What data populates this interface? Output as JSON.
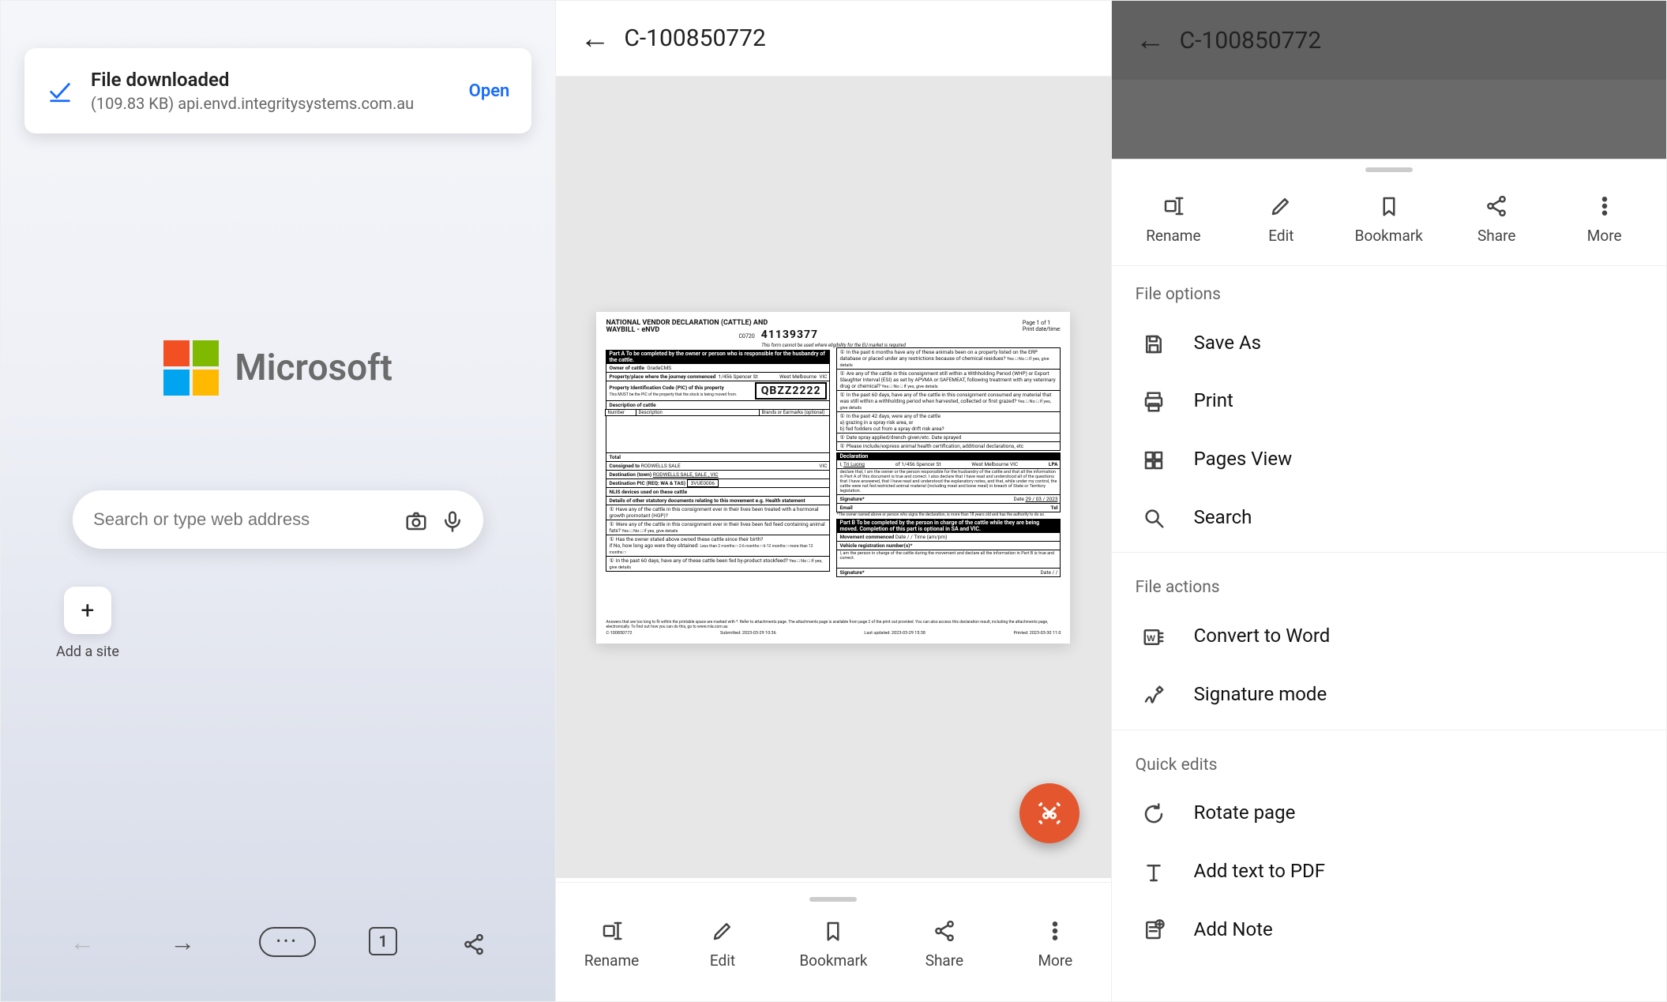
{
  "screen1": {
    "toast": {
      "title": "File downloaded",
      "subtitle": "(109.83 KB) api.envd.integritysystems.com.au",
      "action": "Open"
    },
    "brand": "Microsoft",
    "search_placeholder": "Search or type web address",
    "add_site_label": "Add a site",
    "tab_count": "1"
  },
  "screen2": {
    "title": "C-100850772",
    "toolbar": {
      "rename": "Rename",
      "edit": "Edit",
      "bookmark": "Bookmark",
      "share": "Share",
      "more": "More"
    },
    "document": {
      "heading": "NATIONAL VENDOR DECLARATION (CATTLE) AND WAYBILL - eNVD",
      "page_label": "Page 1 of 1",
      "print_datetime_label": "Print date/time:",
      "form_code": "C0720",
      "serial": "41139377",
      "eu_note": "This form cannot be used where eligibility for the EU market is required",
      "partA_bar": "Part A    To be completed by the owner or person who is responsible for the husbandry of the cattle.",
      "owner_label": "Owner of cattle",
      "owner_value": "GradeCMS",
      "journey_label": "Property/place where the journey commenced",
      "journey_addr": "1/456 Spencer St",
      "journey_city": "West Melbourne",
      "journey_state": "VIC",
      "pic_label": "Property Identification Code (PIC) of this property",
      "pic_sub": "This MUST be the PIC of the property that the stock is being moved from.",
      "pic_value": "QBZZ2222",
      "desc_label": "Description of cattle",
      "col_number": "Number",
      "col_desc": "Description",
      "col_brands": "Brands or Earmarks (optional)",
      "total_label": "Total",
      "consigned_label": "Consigned to",
      "consigned_value": "RODWELLS SALE",
      "consigned_state": "VIC",
      "dest_label": "Destination (town)",
      "dest_value": "RODWELLS SALE, SALE , VIC",
      "dest_pic_label": "Destination PIC (REQ: WA & TAS)",
      "dest_pic_value": "3VUE0006",
      "nlis_label": "NLIS devices used on these cattle",
      "other_docs_label": "Details of other statutory documents relating to this movement e.g. Health statement",
      "q3": "Have any of the cattle in this consignment ever in their lives been treated with a hormonal growth promotant (HGP)?",
      "q4": "Were any of the cattle in this consignment ever in their lives been fed feed containing animal fats?",
      "q5": "Has the owner stated above owned these cattle since their birth?",
      "q5a": "if No, how long ago were they obtained:",
      "q5a_opts": "Less than 2 months □   2-6 months □   6-12 months □   more than 12 months □",
      "q6": "In the past 60 days, have any of these cattle been fed by-product stockfeed?",
      "yn_suffix": " Yes □   No □   If yes, give details",
      "attach_note": "Answers that are too long to fit within the printable space are marked with *. Refer to attachments page. The attachments page is available from page 2 of the print out provided. You can also access this declaration result, including the attachments page, electronically. To find out how you can do this, go to www.mla.com.au",
      "qA": "In the past 6 months have any of these animals been on a property listed on the ERP database or placed under any restrictions because of chemical residues?",
      "qB": "Are any of the cattle in this consignment still within a Withholding Period (WHP) or Export Slaughter Interval (ESI) as set by APVMA or SAFEMEAT, following treatment with any veterinary drug or chemical?",
      "qC": "In the past 60 days, have any of the cattle in this consignment consumed any material that was still within a withholding period when harvested, collected or first grazed?",
      "qD": "In the past 42 days, were any of the cattle",
      "qD_a": "a)  grazing in a spray risk area, or",
      "qD_b": "b)  fed fodders cut from a spray drift risk area?",
      "qE_label": "Date spray applied/drench given/etc.   Date sprayed",
      "qF": "Please include/express animal health certification, additional declarations, etc",
      "decl_bar": "Declaration",
      "decl_name": "Tri Luong",
      "decl_addr": "1/456 Spencer St",
      "decl_city": "West Melbourne",
      "decl_state": "VIC",
      "decl_lpa_text": "LPA",
      "decl_text": "declare that, I am the owner or the person responsible for the husbandry of the cattle and that all the information in Part A of this document is true and correct. I also declare that I have read and understood all of the questions that I have answered, that I have read and understood the explanatory notes, and that, while under my control, the cattle were not fed restricted animal material (including meat and bone meal) in breach of State or Territory legislation.",
      "sig_label": "Signature*",
      "sig_date_label": "Date",
      "sig_date": "29 / 03 / 2023",
      "email_label": "Email",
      "tel_label": "Tel",
      "sig_note": "*The owner named above or person who signs the declaration, is more than 18 years old and has the authority to do so.",
      "partB_bar": "Part B    To be completed by the person in charge of the cattle while they are being moved. Completion of this part is optional in SA and VIC.",
      "partB_commenced": "Movement commenced",
      "partB_date": "Date   /   /",
      "partB_time": "Time (am/pm)",
      "partB_veh": "Vehicle registration number(s)*",
      "partB_decl": "I,                                                  am the person in charge of the cattle during the movement and declare all the information in Part B is true and correct.",
      "footer_id": "C-100850772",
      "footer_submitted": "Submitted: 2023-03-29 10:36",
      "footer_updated": "Last updated: 2023-03-29 15:38",
      "footer_printed": "Printed: 2023-03-30 11:0"
    }
  },
  "screen3": {
    "title": "C-100850772",
    "quick": {
      "rename": "Rename",
      "edit": "Edit",
      "bookmark": "Bookmark",
      "share": "Share",
      "more": "More"
    },
    "section_file_options": "File options",
    "save_as": "Save As",
    "print": "Print",
    "pages_view": "Pages View",
    "search": "Search",
    "section_file_actions": "File actions",
    "convert_word": "Convert to Word",
    "signature_mode": "Signature mode",
    "section_quick_edits": "Quick edits",
    "rotate_page": "Rotate page",
    "add_text": "Add text to PDF",
    "add_note": "Add Note"
  }
}
